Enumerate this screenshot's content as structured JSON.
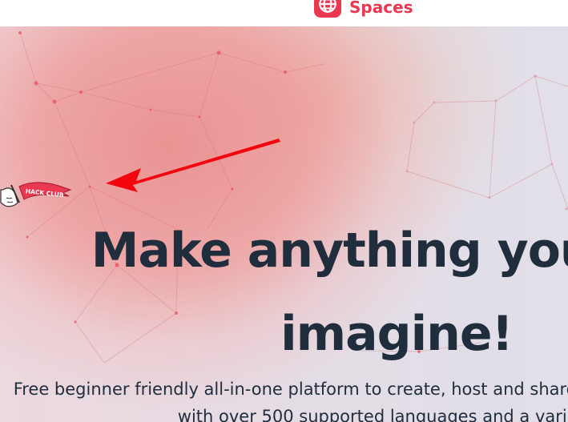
{
  "nav": {
    "brand_name": "Spaces",
    "brand_icon": "globe-icon"
  },
  "hero": {
    "headline": "Make anything you can imagine!",
    "subtitle": "Free beginner friendly all-in-one platform to create, host and share projects with a web IDE with over 500 supported languages and a variety of",
    "flag_text": "HACK CLUB"
  },
  "colors": {
    "brand": "#ec3750",
    "text": "#1f2d3d",
    "arrow": "#f2050f"
  }
}
